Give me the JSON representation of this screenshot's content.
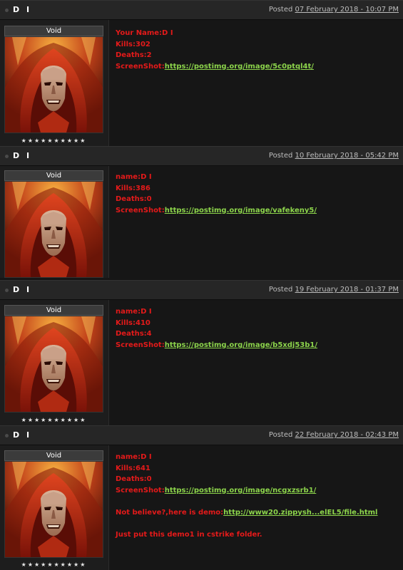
{
  "posts": [
    {
      "author": "D I",
      "posted_label": "Posted",
      "date": "07 February 2018 - 10:07 PM",
      "group_title": "Void",
      "stars": "★★★★★★★★★★",
      "lines": [
        {
          "label": "Your Name:D I"
        },
        {
          "label": "Kills:302"
        },
        {
          "label": "Deaths:2"
        },
        {
          "label": "ScreenShot:",
          "link": "https://postimg.org/image/5c0ptql4t/"
        }
      ]
    },
    {
      "author": "D I",
      "posted_label": "Posted",
      "date": "10 February 2018 - 05:42 PM",
      "group_title": "Void",
      "stars": "",
      "lines": [
        {
          "label": "name:D I"
        },
        {
          "label": "Kills:386"
        },
        {
          "label": "Deaths:0"
        },
        {
          "label": "ScreenShot:",
          "link": "https://postimg.org/image/vafekeny5/"
        }
      ]
    },
    {
      "author": "D I",
      "posted_label": "Posted",
      "date": "19 February 2018 - 01:37 PM",
      "group_title": "Void",
      "stars": "★★★★★★★★★★",
      "lines": [
        {
          "label": "name:D I"
        },
        {
          "label": "Kills:410"
        },
        {
          "label": "Deaths:4"
        },
        {
          "label": "ScreenShot:",
          "link": "https://postimg.org/image/b5xdj53b1/"
        }
      ]
    },
    {
      "author": "D I",
      "posted_label": "Posted",
      "date": "22 February 2018 - 02:43 PM",
      "group_title": "Void",
      "stars": "★★★★★★★★★★",
      "lines": [
        {
          "label": "name:D I"
        },
        {
          "label": "Kills:641"
        },
        {
          "label": "Deaths:0"
        },
        {
          "label": "ScreenShot:",
          "link": "https://postimg.org/image/ncgxzsrb1/"
        },
        {
          "gap": true
        },
        {
          "label": "Not believe?,here is demo:",
          "link": "http://www20.zippysh...elEL5/file.html"
        },
        {
          "gap": true
        },
        {
          "label": "Just put this demo1 in cstrike folder."
        }
      ]
    }
  ]
}
